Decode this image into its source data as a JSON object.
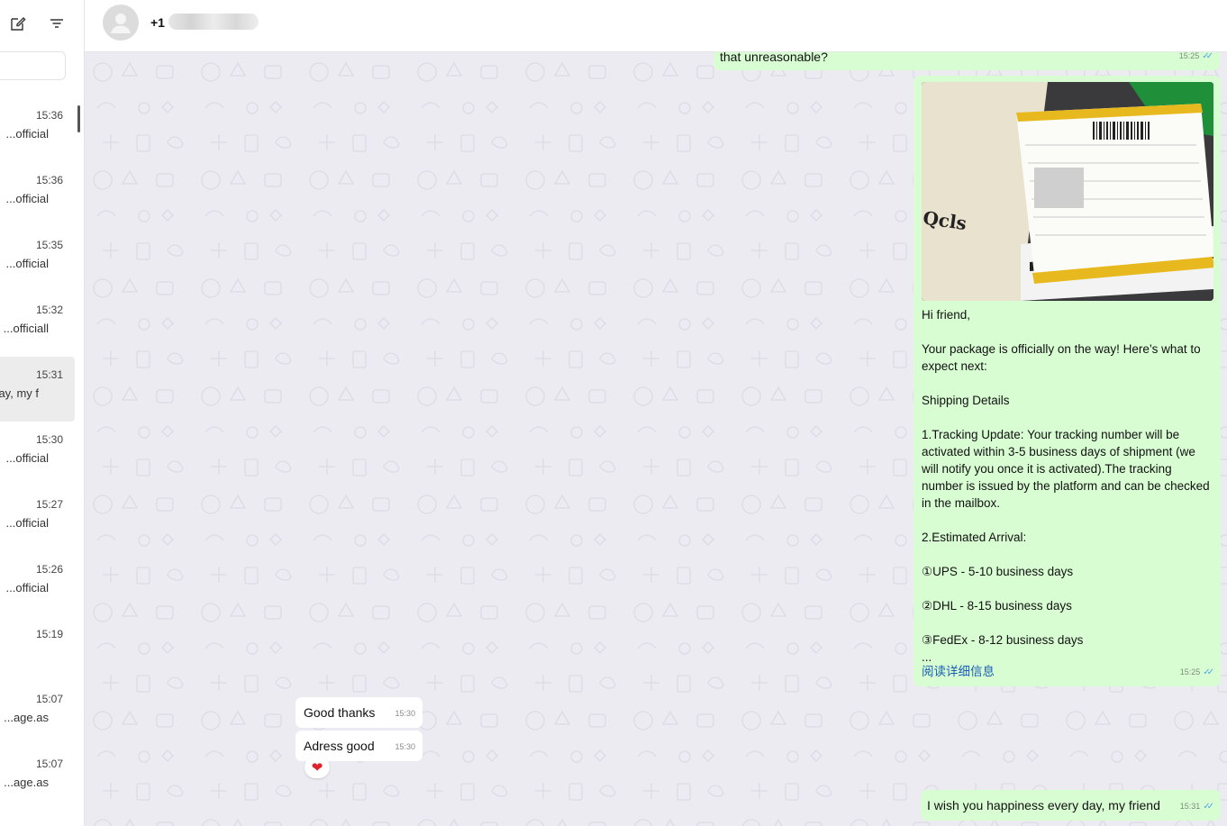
{
  "sidebar": {
    "chats": [
      {
        "time": "15:36",
        "preview": "official..."
      },
      {
        "time": "15:36",
        "preview": "official..."
      },
      {
        "time": "15:35",
        "preview": "official..."
      },
      {
        "time": "15:32",
        "preview": "officiall..."
      },
      {
        "time": "15:31",
        "preview": "ay, my f..."
      },
      {
        "time": "15:30",
        "preview": "official..."
      },
      {
        "time": "15:27",
        "preview": "official..."
      },
      {
        "time": "15:26",
        "preview": "official..."
      },
      {
        "time": "15:19",
        "preview": ""
      },
      {
        "time": "15:07",
        "preview": "age.as..."
      },
      {
        "time": "15:07",
        "preview": "age.as..."
      }
    ],
    "active_index": 4
  },
  "header": {
    "contact_prefix": "+1"
  },
  "messages": {
    "m1": {
      "text": "that unreasonable?",
      "time": "15:25"
    },
    "m2": {
      "lines": [
        "Hi friend,",
        "",
        "Your package is officially on the way!  Here’s what to expect next:",
        "",
        "Shipping Details",
        "",
        "1.Tracking Update: Your tracking number will be activated within 3-5 business days of shipment (we will notify you once it is activated).The tracking number is issued by the platform and can be checked in the mailbox.",
        "",
        "2.Estimated Arrival:",
        "",
        "①UPS - 5-10 business days",
        "",
        "②DHL - 8-15 business days",
        "",
        "③FedEx - 8-12 business days",
        "..."
      ],
      "read_more": "阅读详细信息",
      "time": "15:25",
      "photo_text": "Qcls"
    },
    "m3": {
      "text": "Good thanks",
      "time": "15:30"
    },
    "m4": {
      "text": "Adress good",
      "time": "15:30"
    },
    "m5": {
      "text": "I wish you happiness every day, my friend",
      "time": "15:31"
    }
  },
  "icons": {
    "compose": "compose-icon",
    "filter": "filter-icon",
    "read_receipt": "double-check-icon",
    "reaction": "heart-icon"
  },
  "colors": {
    "outgoing_bubble": "#d9fdd3",
    "incoming_bubble": "#ffffff",
    "chat_background": "#ecebf2",
    "read_tick": "#4fa6e8"
  }
}
